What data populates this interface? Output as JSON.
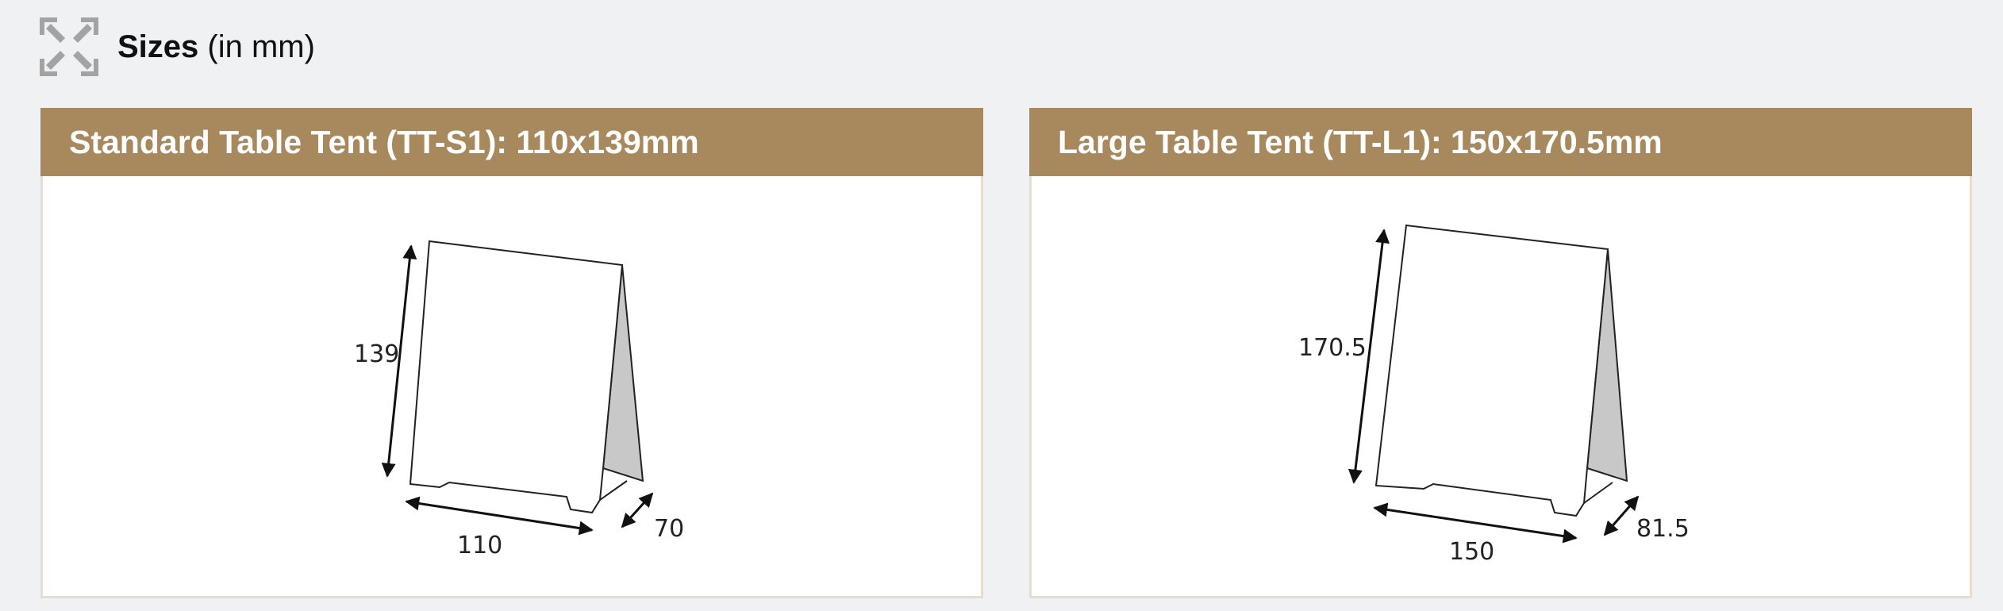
{
  "section": {
    "icon": "expand-arrows-icon",
    "title_bold": "Sizes",
    "title_unit": "(in mm)"
  },
  "products": [
    {
      "title": "Standard Table Tent (TT-S1): 110x139mm",
      "height_label": "139",
      "width_label": "110",
      "depth_label": "70"
    },
    {
      "title": "Large Table Tent (TT-L1): 150x170.5mm",
      "height_label": "170.5",
      "width_label": "150",
      "depth_label": "81.5"
    }
  ],
  "colors": {
    "header_bar": "#a8885d",
    "card_border": "#e6dccf",
    "page_bg": "#f0f1f3",
    "tent_side": "#c8c8c8"
  }
}
